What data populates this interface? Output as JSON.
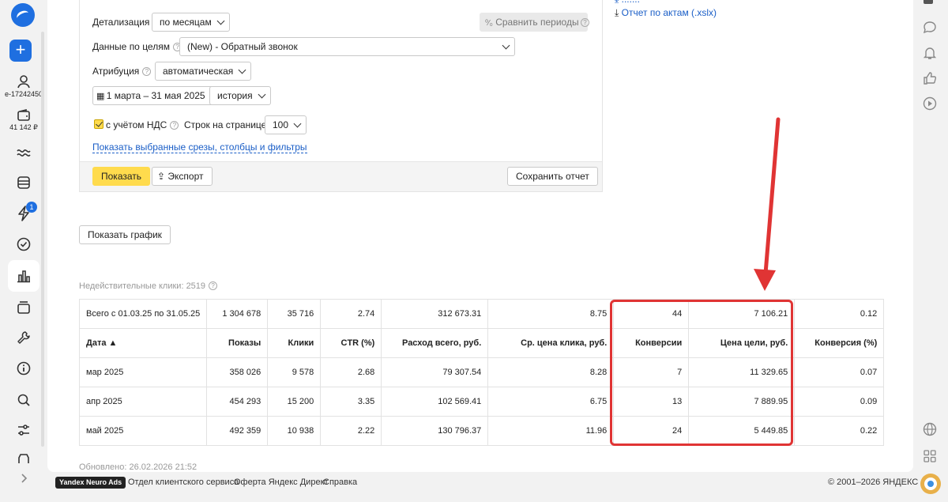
{
  "rail": {
    "account_id": "e-17242450",
    "balance": "41 142 ₽",
    "badge_count": "1"
  },
  "filters": {
    "detail_label": "Детализация",
    "detail_value": "по месяцам",
    "compare_label": "Сравнить периоды",
    "goals_label": "Данные по целям",
    "goals_value": "(New) - Обратный звонок",
    "attribution_label": "Атрибуция",
    "attribution_value": "автоматическая",
    "date_range": "1 марта – 31 мая 2025",
    "history_value": "история",
    "vat_label": "с учётом НДС",
    "rows_label": "Строк на странице",
    "rows_value": "100",
    "show_slices_link": "Показать выбранные срезы, столбцы и фильтры",
    "show_button": "Показать",
    "export_button": "Экспорт",
    "save_button": "Сохранить отчет"
  },
  "downloads": {
    "acts_report": "Отчет по актам (.xslx)"
  },
  "show_chart_button": "Показать график",
  "invalid_clicks": "Недействительные клики: 2519",
  "table": {
    "total_row": [
      "Всего с 01.03.25 по 31.05.25",
      "1 304 678",
      "35 716",
      "2.74",
      "312 673.31",
      "8.75",
      "44",
      "7 106.21",
      "0.12"
    ],
    "headers": [
      "Дата ▲",
      "Показы",
      "Клики",
      "CTR (%)",
      "Расход всего, руб.",
      "Ср. цена клика, руб.",
      "Конверсии",
      "Цена цели, руб.",
      "Конверсия (%)"
    ],
    "rows": [
      [
        "мар 2025",
        "358 026",
        "9 578",
        "2.68",
        "79 307.54",
        "8.28",
        "7",
        "11 329.65",
        "0.07"
      ],
      [
        "апр 2025",
        "454 293",
        "15 200",
        "3.35",
        "102 569.41",
        "6.75",
        "13",
        "7 889.95",
        "0.09"
      ],
      [
        "май 2025",
        "492 359",
        "10 938",
        "2.22",
        "130 796.37",
        "11.96",
        "24",
        "5 449.85",
        "0.22"
      ]
    ]
  },
  "updated": "Обновлено: 26.02.2026 21:52",
  "footer": {
    "brand": "Yandex Neuro Ads",
    "links": [
      "Отдел клиентского сервиса",
      "Оферта Яндекс Директ",
      "Справка"
    ],
    "copyright": "© 2001–2026 ЯНДЕКС"
  },
  "colors": {
    "accent": "#1f6fe0",
    "primary_button": "#ffdb4d",
    "highlight": "#e03434",
    "link": "#1a5ec7"
  }
}
